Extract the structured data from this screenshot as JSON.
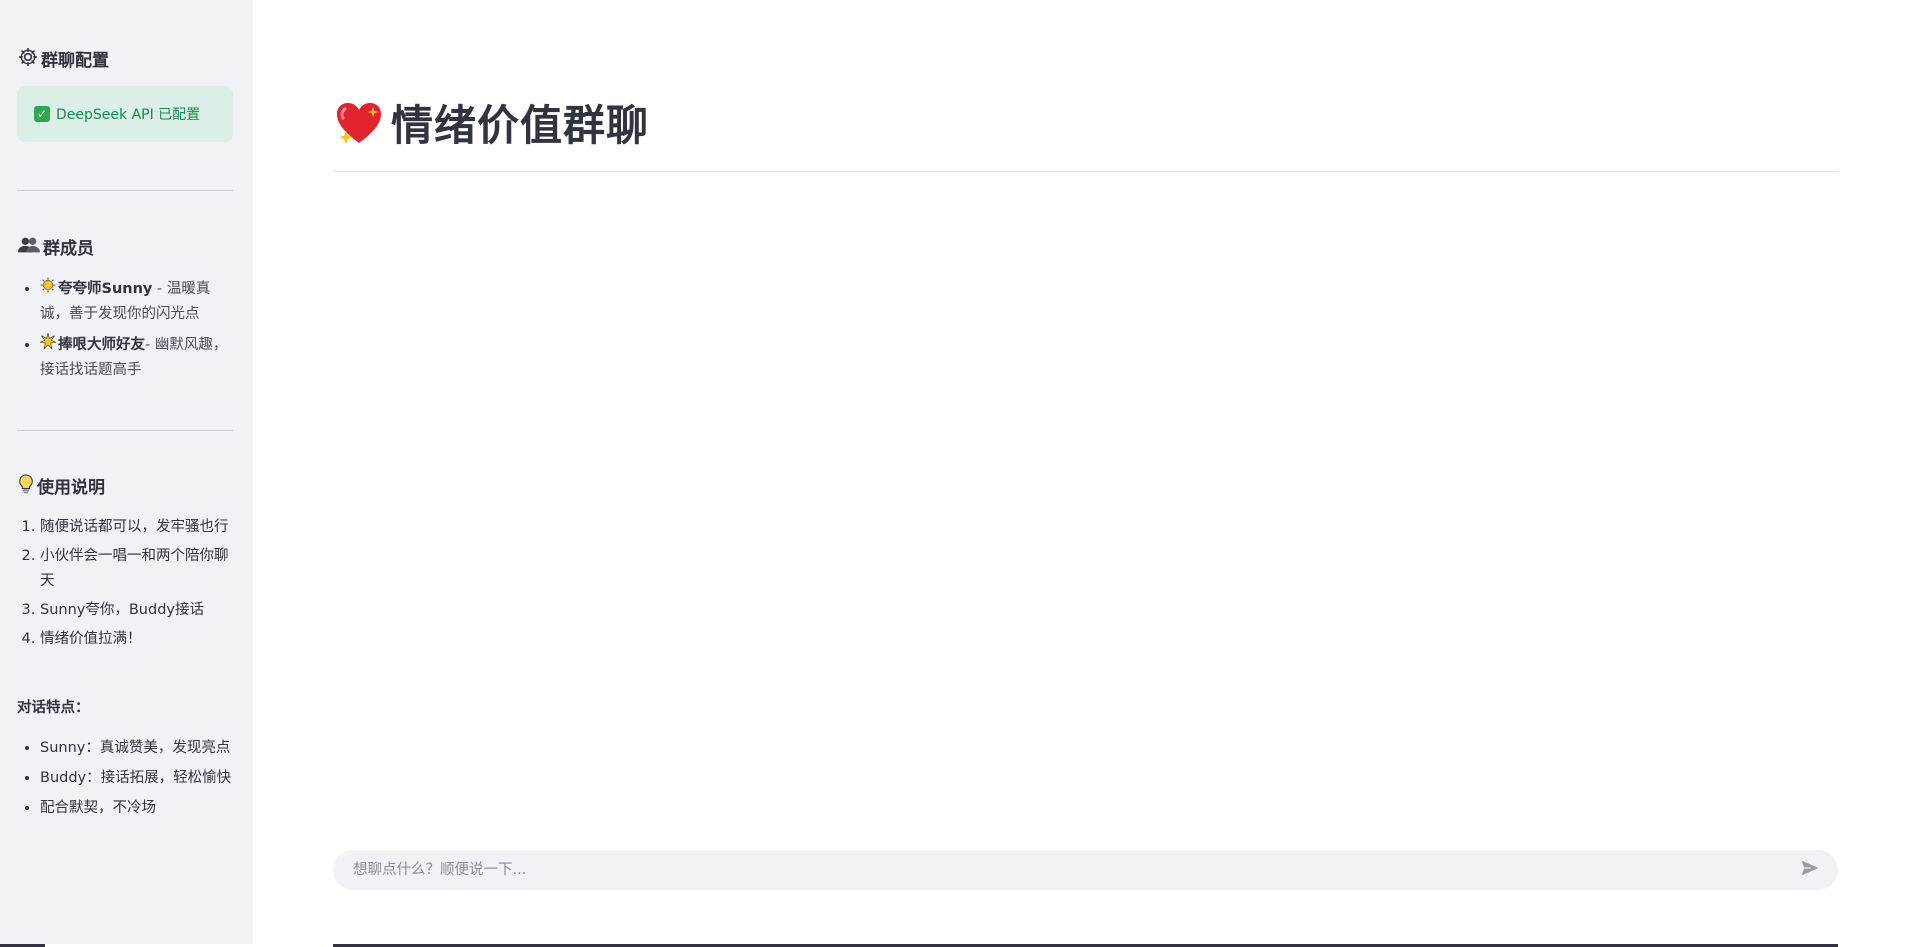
{
  "sidebar": {
    "config": {
      "title": "群聊配置",
      "icon": "gear-icon",
      "status_text": "DeepSeek API 已配置",
      "status_icon": "check-icon",
      "status_color": "#178a4e"
    },
    "members": {
      "title": "群成员",
      "icon": "people-icon",
      "items": [
        {
          "icon": "sun-icon",
          "name": "夸夸师Sunny",
          "desc": " - 温暖真诚，善于发现你的闪光点"
        },
        {
          "icon": "burst-icon",
          "name": "捧哏大师好友",
          "desc": "- 幽默风趣，接话找话题高手"
        }
      ]
    },
    "guide": {
      "title": "使用说明",
      "icon": "lightbulb-icon",
      "steps": [
        "随便说话都可以，发牢骚也行",
        "小伙伴会一唱一和两个陪你聊天",
        "Sunny夸你，Buddy接话",
        "情绪价值拉满！"
      ],
      "features_title": "对话特点：",
      "features": [
        "Sunny：真诚赞美，发现亮点",
        "Buddy：接话拓展，轻松愉快",
        "配合默契，不冷场"
      ]
    }
  },
  "main": {
    "title": "情绪价值群聊",
    "title_icon": "sparkling-heart-icon",
    "chat_input": {
      "placeholder": "想聊点什么？顺便说一下...",
      "value": ""
    },
    "send_icon": "send-icon"
  },
  "colors": {
    "sidebar_bg": "#f0f2f6",
    "status_bg": "#dcefe6",
    "text": "#31333f"
  }
}
